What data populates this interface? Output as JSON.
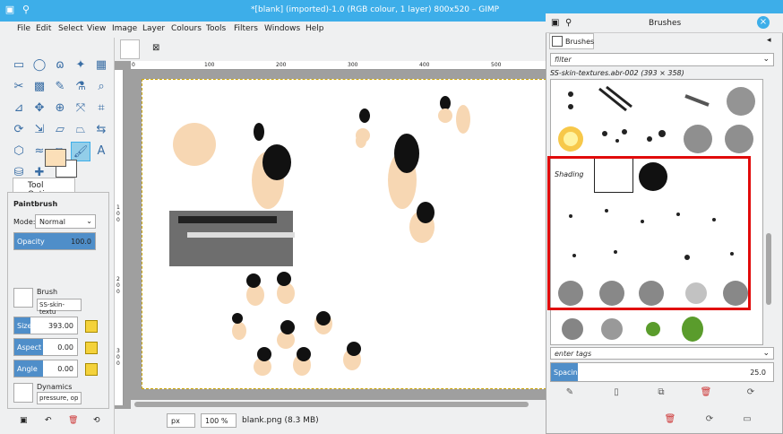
{
  "window": {
    "title": "*[blank] (imported)-1.0 (RGB colour, 1 layer) 800x520 – GIMP"
  },
  "menu": [
    "File",
    "Edit",
    "Select",
    "View",
    "Image",
    "Layer",
    "Colours",
    "Tools",
    "Filters",
    "Windows",
    "Help"
  ],
  "tool_options": {
    "tab_label": "Tool Options",
    "tool_name": "Paintbrush",
    "mode_label": "Mode:",
    "mode_value": "Normal",
    "opacity_label": "Opacity",
    "opacity_value": "100.0",
    "opacity_fraction": 1.0,
    "brush_label": "Brush",
    "brush_value": "SS-skin-textu",
    "size_label": "Size",
    "size_value": "393.00",
    "aspect_label": "Aspect R",
    "aspect_value": "0.00",
    "angle_label": "Angle",
    "angle_value": "0.00",
    "dynamics_label": "Dynamics",
    "dynamics_value": "pressure, op"
  },
  "rulers": {
    "h_ticks": [
      "0",
      "100",
      "200",
      "300",
      "400",
      "500",
      "600",
      "700"
    ],
    "v_ticks": [
      "1",
      "0",
      "0",
      "2",
      "0",
      "0",
      "3",
      "0",
      "0",
      "4",
      "0",
      "0",
      "5"
    ]
  },
  "statusbar": {
    "unit": "px",
    "zoom": "100 %",
    "file": "blank.png (8.3 MB)"
  },
  "brushes": {
    "dialog_title": "Brushes",
    "tab_label": "Brushes",
    "filter_placeholder": "filter",
    "current_brush": "SS-skin-textures.abr-002 (393 × 358)",
    "tags_placeholder": "enter tags",
    "spacing_label": "Spacing",
    "spacing_value": "25.0",
    "spacing_fraction": 0.12
  },
  "colors": {
    "accent": "#3daee9",
    "highlight": "#e10b0b",
    "foreground": "#fbdfb8"
  }
}
